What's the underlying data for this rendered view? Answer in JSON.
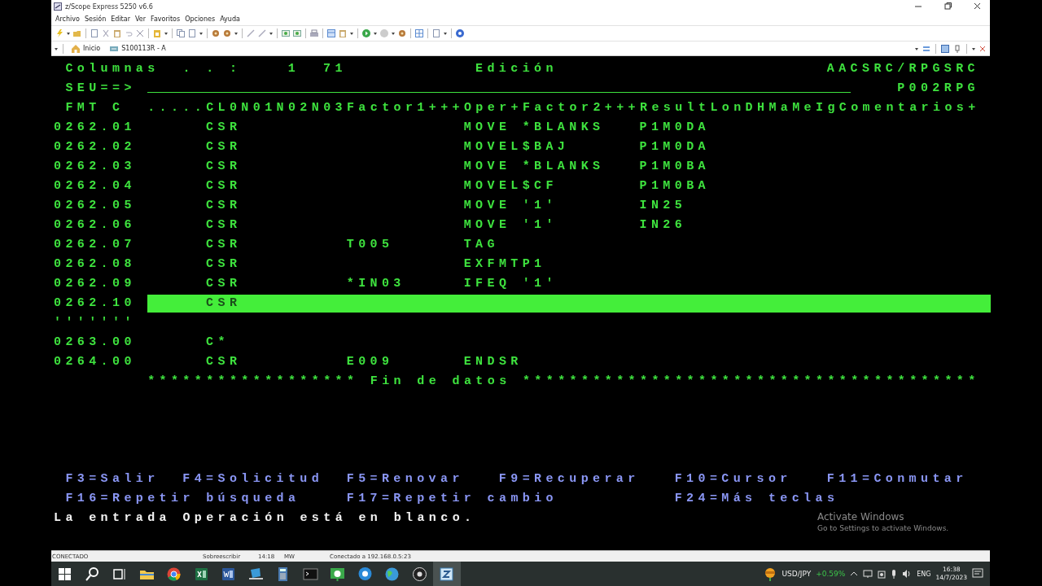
{
  "window": {
    "title": "z/Scope Express 5250 v6.6"
  },
  "menu": [
    "Archivo",
    "Sesión",
    "Editar",
    "Ver",
    "Favoritos",
    "Opciones",
    "Ayuda"
  ],
  "tabs": [
    {
      "label": "Inicio",
      "kind": "home"
    },
    {
      "label": "S100113R - A",
      "kind": "session"
    }
  ],
  "terminal": {
    "header": {
      "label": "Columnas  . . :",
      "from": "1",
      "to": "71",
      "mode": "Edición",
      "source": "AACSRC/RPGSRC"
    },
    "prompt": {
      "label": "SEU==>",
      "member": "P002RPG"
    },
    "format": {
      "label": "FMT C",
      "ruler": ".....CL0N01N02N03Factor1+++Oper+Factor2+++ResultLonDHMaMeIgComentarios+"
    },
    "lines": [
      {
        "seq": "0262.01",
        "spec": "CSR",
        "op": "MOVE",
        "factor2": "*BLANKS",
        "result": "P1M0DA",
        "highlighted": false
      },
      {
        "seq": "0262.02",
        "spec": "CSR",
        "op": "MOVEL",
        "factor2": "$BAJ",
        "result": "P1M0DA",
        "highlighted": false
      },
      {
        "seq": "0262.03",
        "spec": "CSR",
        "op": "MOVE",
        "factor2": "*BLANKS",
        "result": "P1M0BA",
        "highlighted": false
      },
      {
        "seq": "0262.04",
        "spec": "CSR",
        "op": "MOVEL",
        "factor2": "$CF",
        "result": "P1M0BA",
        "highlighted": false
      },
      {
        "seq": "0262.05",
        "spec": "CSR",
        "op": "MOVE",
        "factor2": "'1'",
        "result": "IN25",
        "highlighted": false
      },
      {
        "seq": "0262.06",
        "spec": "CSR",
        "op": "MOVE",
        "factor2": "'1'",
        "result": "IN26",
        "highlighted": false
      },
      {
        "seq": "0262.07",
        "spec": "CSR",
        "factor1": "T005",
        "op": "TAG",
        "highlighted": false
      },
      {
        "seq": "0262.08",
        "spec": "CSR",
        "op": "EXFMTP1",
        "highlighted": false
      },
      {
        "seq": "0262.09",
        "spec": "CSR",
        "factor1": "*IN03",
        "op": "IFEQ",
        "factor2": "'1'",
        "highlighted": false
      },
      {
        "seq": "0262.10",
        "spec": "CSR",
        "highlighted": true
      },
      {
        "seq": "'''''''",
        "highlighted": false
      },
      {
        "seq": "0263.00",
        "spec": "C*",
        "highlighted": false
      },
      {
        "seq": "0264.00",
        "spec": "CSR",
        "factor1": "E009",
        "op": "ENDSR",
        "highlighted": false
      }
    ],
    "end_marker": "****************** Fin de datos ***************************************",
    "function_keys": [
      [
        "F3=Salir",
        "F4=Solicitud",
        "F5=Renovar",
        "F9=Recuperar",
        "F10=Cursor",
        "F11=Conmutar"
      ],
      [
        "F16=Repetir búsqueda",
        "F17=Repetir cambio",
        "F24=Más teclas"
      ]
    ],
    "message": "La entrada Operación está en blanco."
  },
  "os_notice": {
    "title": "Activate Windows",
    "text": "Go to Settings to activate Windows."
  },
  "status_bar": [
    "CONECTADO",
    "Sobreescribir",
    "14:18",
    "MW",
    "Conectado a 192.168.0.5:23"
  ],
  "taskbar": {
    "ticker": {
      "symbol": "USD/JPY",
      "change": "+0.59%"
    },
    "language": "ENG",
    "time": "16:38",
    "date": "14/7/2023"
  }
}
